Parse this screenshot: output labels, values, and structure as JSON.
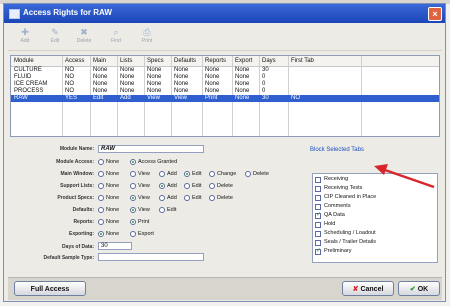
{
  "window": {
    "title": "Access Rights for RAW",
    "close_glyph": "×"
  },
  "toolbar": [
    {
      "label": "Add",
      "icon": "add-icon",
      "glyph": "✚"
    },
    {
      "label": "Edit",
      "icon": "edit-icon",
      "glyph": "✎"
    },
    {
      "label": "Delete",
      "icon": "delete-icon",
      "glyph": "✖"
    },
    {
      "label": "Find",
      "icon": "find-icon",
      "glyph": "⌕"
    },
    {
      "label": "Print",
      "icon": "print-icon",
      "glyph": "⎙"
    }
  ],
  "grid": {
    "columns": [
      "Module",
      "Access",
      "Main",
      "Lists",
      "Specs",
      "Defaults",
      "Reports",
      "Export",
      "Days",
      "First Tab"
    ],
    "rows": [
      [
        "CULTURE",
        "NO",
        "None",
        "None",
        "None",
        "None",
        "None",
        "None",
        "30",
        ""
      ],
      [
        "FLUID",
        "NO",
        "None",
        "None",
        "None",
        "None",
        "None",
        "None",
        "0",
        ""
      ],
      [
        "ICE CREAM",
        "NO",
        "None",
        "None",
        "None",
        "None",
        "None",
        "None",
        "0",
        ""
      ],
      [
        "PROCESS",
        "NO",
        "None",
        "None",
        "None",
        "None",
        "None",
        "None",
        "0",
        ""
      ],
      [
        "RAW",
        "YES",
        "Edit",
        "Add",
        "View",
        "View",
        "Print",
        "None",
        "30",
        "NO"
      ]
    ],
    "selected_row": 4
  },
  "form": {
    "module_name_label": "Module Name:",
    "module_name_value": "RAW",
    "module_access": {
      "label": "Module Access:",
      "options": [
        "None",
        "Access Granted"
      ],
      "selected": "Access Granted"
    },
    "main_window": {
      "label": "Main Window:",
      "options": [
        "None",
        "View",
        "Add",
        "Edit",
        "Change",
        "Delete"
      ],
      "selected": "Edit"
    },
    "support_lists": {
      "label": "Support Lists:",
      "options": [
        "None",
        "View",
        "Add",
        "Edit",
        "Delete"
      ],
      "selected": "Add"
    },
    "product_specs": {
      "label": "Product Specs:",
      "options": [
        "None",
        "View",
        "Add",
        "Edit",
        "Delete"
      ],
      "selected": "View"
    },
    "defaults": {
      "label": "Defaults:",
      "options": [
        "None",
        "View",
        "Edit"
      ],
      "selected": "View"
    },
    "reports": {
      "label": "Reports:",
      "options": [
        "None",
        "Print"
      ],
      "selected": "Print"
    },
    "exporting": {
      "label": "Exporting:",
      "options": [
        "None",
        "Export"
      ],
      "selected": "None"
    },
    "days_label": "Days of Data:",
    "days_value": "30",
    "sample_type_label": "Default Sample Type:",
    "sample_type_value": ""
  },
  "tabs": {
    "title": "Block Selected Tabs",
    "items": [
      {
        "label": "Receiving",
        "checked": false
      },
      {
        "label": "Receiving Tests",
        "checked": false
      },
      {
        "label": "CIP Cleaned in Place",
        "checked": false
      },
      {
        "label": "Comments",
        "checked": false
      },
      {
        "label": "QA Data",
        "checked": true
      },
      {
        "label": "Hold",
        "checked": false
      },
      {
        "label": "Scheduling / Loadout",
        "checked": false
      },
      {
        "label": "Seals / Trailer Details",
        "checked": false
      },
      {
        "label": "Preliminary",
        "checked": true
      }
    ]
  },
  "buttons": {
    "full_access": "Full Access",
    "cancel": "Cancel",
    "ok": "OK",
    "cancel_glyph": "✘",
    "ok_glyph": "✔"
  },
  "colors": {
    "title_bar": "#2553c7",
    "selected_row": "#2f5fcf",
    "link_blue": "#1d4fc0",
    "arrow_red": "#d8262b",
    "check_green": "#2a9a2a"
  }
}
